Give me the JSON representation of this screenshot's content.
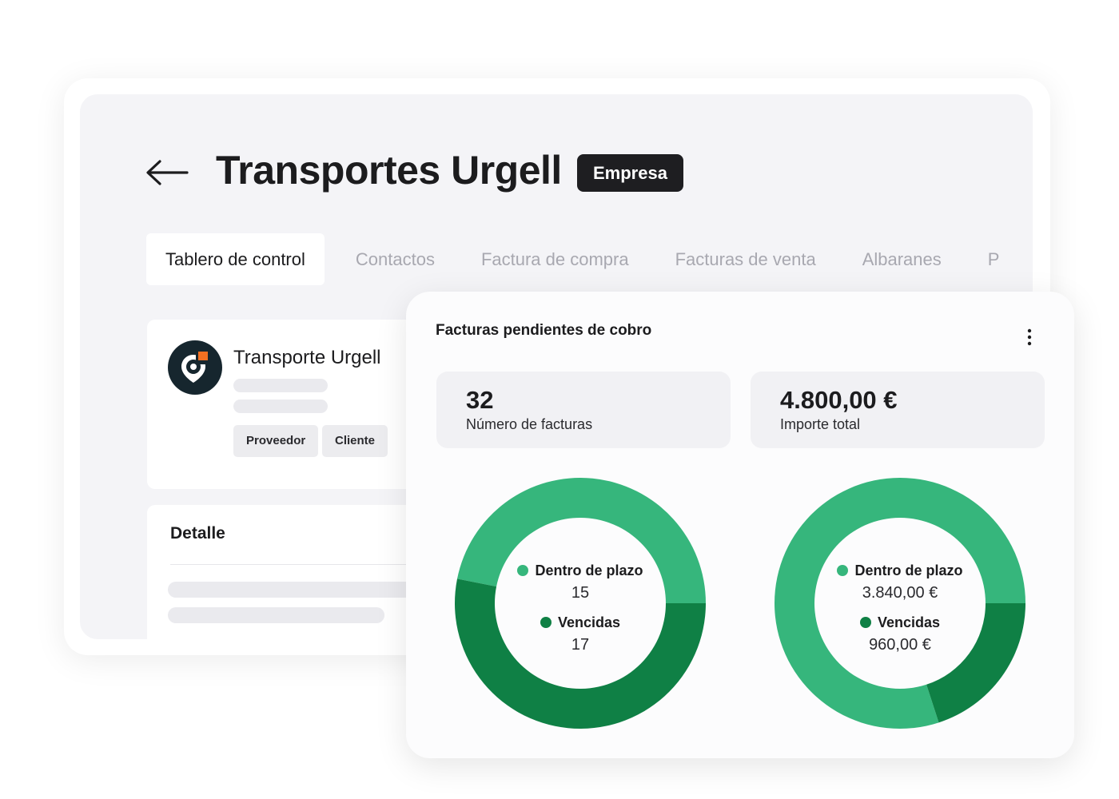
{
  "header": {
    "title": "Transportes Urgell",
    "badge": "Empresa"
  },
  "tabs": [
    {
      "label": "Tablero de control",
      "active": true
    },
    {
      "label": "Contactos"
    },
    {
      "label": "Factura de compra"
    },
    {
      "label": "Facturas de venta"
    },
    {
      "label": "Albaranes"
    },
    {
      "label": "P"
    }
  ],
  "company": {
    "name": "Transporte Urgell",
    "chips": [
      "Proveedor",
      "Cliente"
    ]
  },
  "detail": {
    "title": "Detalle"
  },
  "invoices": {
    "title": "Facturas pendientes de cobro",
    "stats": [
      {
        "value": "32",
        "label": "Número de facturas"
      },
      {
        "value": "4.800,00 €",
        "label": "Importe total"
      }
    ],
    "donuts": [
      {
        "in_term_label": "Dentro de plazo",
        "in_term_value": "15",
        "in_term_amount": 15,
        "overdue_label": "Vencidas",
        "overdue_value": "17",
        "overdue_amount": 17
      },
      {
        "in_term_label": "Dentro de plazo",
        "in_term_value": "3.840,00 €",
        "in_term_amount": 3840,
        "overdue_label": "Vencidas",
        "overdue_value": "960,00 €",
        "overdue_amount": 960
      }
    ]
  },
  "colors": {
    "in_term": "#36b67c",
    "overdue": "#0f8045",
    "brand_orange": "#f37021",
    "dark": "#1e1e21"
  },
  "icons": {
    "back": "arrow-left-icon",
    "menu": "more-vertical-icon",
    "logo": "location-pin-logo-icon"
  }
}
